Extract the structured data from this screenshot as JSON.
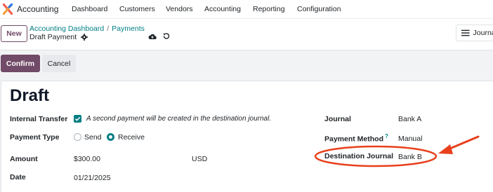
{
  "navbar": {
    "app_name": "Accounting",
    "menu": [
      "Dashboard",
      "Customers",
      "Vendors",
      "Accounting",
      "Reporting",
      "Configuration"
    ]
  },
  "control_panel": {
    "new_label": "New",
    "breadcrumb": [
      "Accounting Dashboard",
      "Payments"
    ],
    "breadcrumb_separator": "/",
    "record_name": "Draft Payment",
    "journal_button": "Journal"
  },
  "statusbar": {
    "confirm_label": "Confirm",
    "cancel_label": "Cancel"
  },
  "form": {
    "title": "Draft",
    "internal_transfer_label": "Internal Transfer",
    "internal_transfer_checked": true,
    "internal_transfer_hint": "A second payment will be created in the destination journal.",
    "payment_type_label": "Payment Type",
    "payment_type_options": [
      "Send",
      "Receive"
    ],
    "payment_type_selected": "Receive",
    "amount_label": "Amount",
    "amount_value": "$300.00",
    "currency": "USD",
    "date_label": "Date",
    "date_value": "01/21/2025",
    "journal_label": "Journal",
    "journal_value": "Bank A",
    "payment_method_label": "Payment Method",
    "payment_method_help": "?",
    "payment_method_value": "Manual",
    "destination_journal_label": "Destination Journal",
    "destination_journal_value": "Bank B"
  },
  "colors": {
    "brand": "#714b67",
    "accent": "#017e84",
    "annotation": "#e8401c"
  }
}
